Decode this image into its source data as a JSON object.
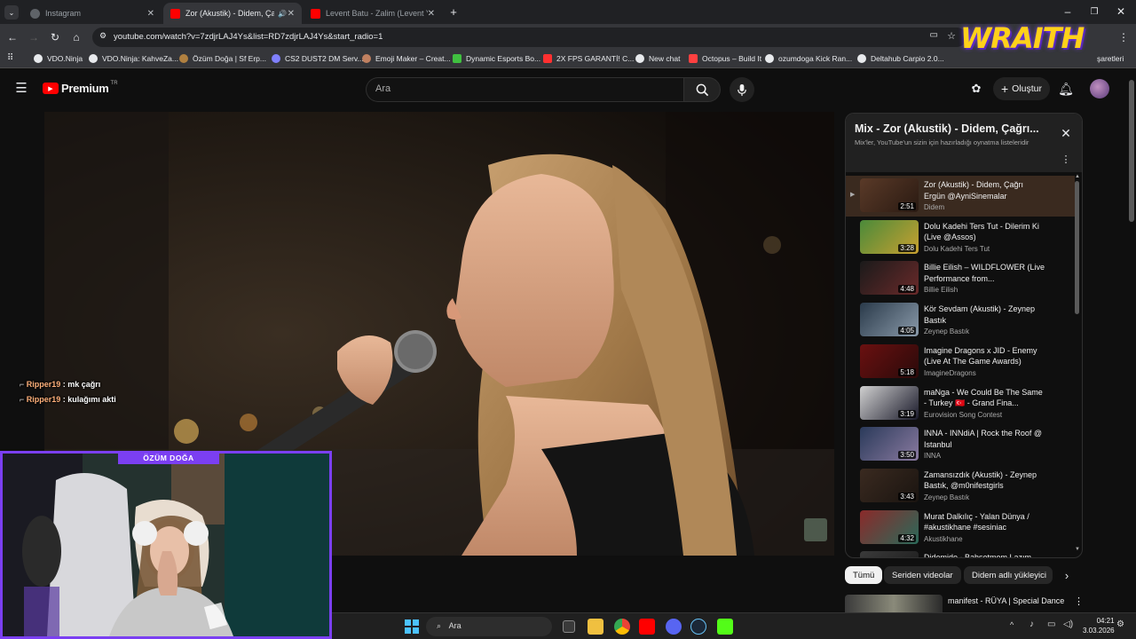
{
  "browser": {
    "tabs": [
      {
        "label": "Instagram",
        "favicon_color": "#5f6368"
      },
      {
        "label": "Zor (Akustik) - Didem, Çağrı",
        "favicon_color": "#ff0000"
      },
      {
        "label": "Levent Batu - Zalim (Levent Yü",
        "favicon_color": "#ff0000"
      }
    ],
    "url": "youtube.com/watch?v=7zdjrLAJ4Ys&list=RD7zdjrLAJ4Ys&start_radio=1",
    "bookmarks": [
      {
        "label": "VDO.Ninja"
      },
      {
        "label": "VDO.Ninja: KahveZa..."
      },
      {
        "label": "Özüm Doğa | Sf Erp..."
      },
      {
        "label": "CS2 DUST2 DM Serv..."
      },
      {
        "label": "Emoji Maker – Creat..."
      },
      {
        "label": "Dynamic Esports Bo..."
      },
      {
        "label": "2X FPS GARANTİ! C..."
      },
      {
        "label": "New chat"
      },
      {
        "label": "Octopus – Build It"
      },
      {
        "label": "ozumdoga Kick Ran..."
      },
      {
        "label": "Deltahub Carpio 2.0..."
      },
      {
        "label": "şaretleri"
      }
    ]
  },
  "overlay": {
    "brand_text": "WRAITH",
    "cam_label": "ÖZÜM DOĞA",
    "chat": [
      {
        "user": "Ripper19",
        "sep": " : ",
        "message": "mk çağrı"
      },
      {
        "user": "Ripper19",
        "sep": " : ",
        "message": "kulağımı akti"
      }
    ]
  },
  "youtube": {
    "logo_text": "Premium",
    "logo_superscript": "TR",
    "search_placeholder": "Ara",
    "create_label": "Oluştur",
    "playlist": {
      "title": "Mix - Zor (Akustik) - Didem, Çağrı...",
      "subtitle": "Mix'ler, YouTube'un sizin için hazırladığı oynatma listeleridir",
      "items": [
        {
          "title": "Zor (Akustik) - Didem, Çağrı Ergün @AyniSinemalar",
          "channel": "Didem",
          "duration": "2:51",
          "current": true,
          "colors": [
            "#5a3a28",
            "#2a1a12"
          ]
        },
        {
          "title": "Dolu Kadehi Ters Tut - Dilerim Ki (Live @Assos)",
          "channel": "Dolu Kadehi Ters Tut",
          "duration": "3:28",
          "current": false,
          "colors": [
            "#4a8a3a",
            "#c8a030"
          ]
        },
        {
          "title": "Billie Eilish – WILDFLOWER (Live Performance from...",
          "channel": "Billie Eilish",
          "duration": "4:48",
          "current": false,
          "colors": [
            "#1a1a1a",
            "#6a2a2a"
          ]
        },
        {
          "title": "Kör Sevdam (Akustik) - Zeynep Bastık",
          "channel": "Zeynep Bastık",
          "duration": "4:05",
          "current": false,
          "colors": [
            "#2a3a4a",
            "#8a9aaa"
          ]
        },
        {
          "title": "Imagine Dragons x JID - Enemy (Live At The Game Awards)",
          "channel": "ImagineDragons",
          "duration": "5:18",
          "current": false,
          "colors": [
            "#6a1010",
            "#2a0a0a"
          ]
        },
        {
          "title": "maNga - We Could Be The Same - Turkey 🇹🇷 - Grand Fina...",
          "channel": "Eurovision Song Contest",
          "duration": "3:19",
          "current": false,
          "colors": [
            "#d0d0d0",
            "#1a1a2a"
          ]
        },
        {
          "title": "INNA - INNdiA | Rock the Roof @ Istanbul",
          "channel": "INNA",
          "duration": "3:50",
          "current": false,
          "colors": [
            "#2a3a5a",
            "#8a7aa0"
          ]
        },
        {
          "title": "Zamansızdık (Akustik) - Zeynep Bastık, @m0nifestgirls",
          "channel": "Zeynep Bastık",
          "duration": "3:43",
          "current": false,
          "colors": [
            "#3a2a20",
            "#1a1410"
          ]
        },
        {
          "title": "Murat Dalkılıç - Yalan Dünya / #akustikhane #sesiniac",
          "channel": "Akustikhane",
          "duration": "4:32",
          "current": false,
          "colors": [
            "#8a2a2a",
            "#2a6a5a"
          ]
        },
        {
          "title": "Didemido - Bahsetmem Lazım",
          "channel": "",
          "duration": "",
          "current": false,
          "colors": [
            "#3a3a3a",
            "#1a1a1a"
          ]
        }
      ]
    },
    "chips": [
      {
        "label": "Tümü",
        "selected": true
      },
      {
        "label": "Seriden videolar",
        "selected": false
      },
      {
        "label": "Didem adlı yükleyici",
        "selected": false
      }
    ],
    "next_video": {
      "title": "manifest - RÜYA | Special Dance"
    }
  },
  "taskbar": {
    "search_label": "Ara",
    "time": "04:21",
    "date": "3.03.2026"
  }
}
